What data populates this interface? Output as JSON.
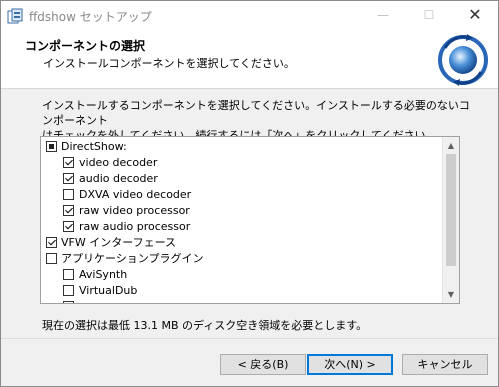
{
  "window": {
    "title": "ffdshow セットアップ"
  },
  "titlebar": {
    "minimize_glyph": "—",
    "maximize_glyph": "☐",
    "close_glyph": "✕"
  },
  "header": {
    "title": "コンポーネントの選択",
    "subtitle": "インストールコンポーネントを選択してください。"
  },
  "description": {
    "line1": "インストールするコンポーネントを選択してください。インストールする必要のないコンポーネント",
    "line2": "はチェックを外してください。続行するには「次へ」をクリックしてください。"
  },
  "components": [
    {
      "label": "DirectShow:",
      "state": "partial",
      "level": 0
    },
    {
      "label": "video decoder",
      "state": "checked",
      "level": 1
    },
    {
      "label": "audio decoder",
      "state": "checked",
      "level": 1
    },
    {
      "label": "DXVA video decoder",
      "state": "unchecked",
      "level": 1
    },
    {
      "label": "raw video processor",
      "state": "checked",
      "level": 1
    },
    {
      "label": "raw audio processor",
      "state": "checked",
      "level": 1
    },
    {
      "label": "VFW インターフェース",
      "state": "checked",
      "level": 0
    },
    {
      "label": "アプリケーションプラグイン",
      "state": "unchecked",
      "level": 0
    },
    {
      "label": "AviSynth",
      "state": "unchecked",
      "level": 1
    },
    {
      "label": "VirtualDub",
      "state": "unchecked",
      "level": 1
    }
  ],
  "space_required": "現在の選択は最低 13.1 MB のディスク空き領域を必要とします。",
  "buttons": {
    "back": "< 戻る(B)",
    "next": "次へ(N) >",
    "cancel": "キャンセル"
  },
  "colors": {
    "accent": "#0078d7"
  }
}
